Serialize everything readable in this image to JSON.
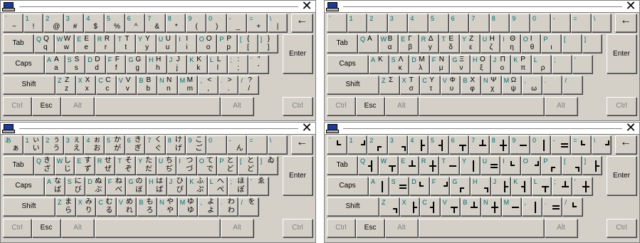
{
  "windows": [
    {
      "id": "english",
      "rows": [
        [
          [
            "`",
            "~",
            ""
          ],
          [
            "1",
            "!",
            ""
          ],
          [
            "2",
            "@",
            ""
          ],
          [
            "3",
            "#",
            ""
          ],
          [
            "4",
            "$",
            ""
          ],
          [
            "5",
            "%",
            ""
          ],
          [
            "6",
            "^",
            ""
          ],
          [
            "7",
            "&",
            ""
          ],
          [
            "8",
            "*",
            ""
          ],
          [
            "9",
            "(",
            ""
          ],
          [
            "0",
            ")",
            ""
          ],
          [
            "-",
            "_",
            ""
          ],
          [
            "=",
            "+",
            ""
          ],
          [
            "\\",
            "|",
            ""
          ]
        ],
        [
          [
            "Q",
            "q",
            "Q"
          ],
          [
            "W",
            "w",
            "W"
          ],
          [
            "E",
            "e",
            "E"
          ],
          [
            "R",
            "r",
            "R"
          ],
          [
            "T",
            "t",
            "T"
          ],
          [
            "Y",
            "y",
            "Y"
          ],
          [
            "U",
            "u",
            "U"
          ],
          [
            "I",
            "i",
            "I"
          ],
          [
            "O",
            "o",
            "O"
          ],
          [
            "P",
            "p",
            "P"
          ],
          [
            "[",
            "[",
            "{"
          ],
          [
            "]",
            "]",
            "}"
          ]
        ],
        [
          [
            "A",
            "a",
            "A"
          ],
          [
            "S",
            "s",
            "S"
          ],
          [
            "D",
            "d",
            "D"
          ],
          [
            "F",
            "f",
            "F"
          ],
          [
            "G",
            "g",
            "G"
          ],
          [
            "H",
            "h",
            "H"
          ],
          [
            "J",
            "j",
            "J"
          ],
          [
            "K",
            "k",
            "K"
          ],
          [
            "L",
            "l",
            "L"
          ],
          [
            ";",
            ";",
            ":"
          ],
          [
            "'",
            "'",
            "\""
          ]
        ],
        [
          [
            "Z",
            "z",
            "Z"
          ],
          [
            "X",
            "x",
            "X"
          ],
          [
            "C",
            "c",
            "C"
          ],
          [
            "V",
            "v",
            "V"
          ],
          [
            "B",
            "b",
            "B"
          ],
          [
            "N",
            "n",
            "N"
          ],
          [
            "M",
            "m",
            "M"
          ],
          [
            ",",
            ",",
            "<"
          ],
          [
            ".",
            ".",
            ">"
          ],
          [
            "/",
            "/",
            "?"
          ]
        ]
      ]
    },
    {
      "id": "greek",
      "rows": [
        [
          [
            "`",
            "",
            ""
          ],
          [
            "1",
            "",
            ""
          ],
          [
            "2",
            "",
            ""
          ],
          [
            "3",
            "",
            ""
          ],
          [
            "4",
            "",
            ""
          ],
          [
            "5",
            "",
            ""
          ],
          [
            "6",
            "",
            ""
          ],
          [
            "7",
            "",
            ""
          ],
          [
            "8",
            "",
            ""
          ],
          [
            "9",
            "",
            ""
          ],
          [
            "0",
            "",
            ""
          ],
          [
            "-",
            "",
            ""
          ],
          [
            "=",
            "",
            ""
          ],
          [
            "\\",
            "",
            ""
          ]
        ],
        [
          [
            "Q",
            "",
            "Α"
          ],
          [
            "W",
            "α",
            "Β"
          ],
          [
            "E",
            "β",
            "Γ"
          ],
          [
            "R",
            "γ",
            "Δ"
          ],
          [
            "T",
            "δ",
            "Ε"
          ],
          [
            "Y",
            "ε",
            "Ζ"
          ],
          [
            "U",
            "ζ",
            "Η"
          ],
          [
            "I",
            "η",
            "Θ"
          ],
          [
            "O",
            "θ",
            "Ι"
          ],
          [
            "P",
            "ι",
            ""
          ],
          [
            "[",
            "",
            ""
          ],
          [
            "]",
            "",
            ""
          ]
        ],
        [
          [
            "A",
            "",
            "Κ"
          ],
          [
            "S",
            "κ",
            "Λ"
          ],
          [
            "D",
            "λ",
            "Μ"
          ],
          [
            "F",
            "μ",
            "Ν"
          ],
          [
            "G",
            "ν",
            "Ξ"
          ],
          [
            "H",
            "ξ",
            "Ο"
          ],
          [
            "J",
            "ο",
            "Π"
          ],
          [
            "K",
            "π",
            "Ρ"
          ],
          [
            "L",
            "ρ",
            ""
          ],
          [
            ";",
            "",
            ""
          ],
          [
            "'",
            "",
            ""
          ]
        ],
        [
          [
            "Z",
            "",
            "Σ"
          ],
          [
            "X",
            "σ",
            "Τ"
          ],
          [
            "C",
            "τ",
            "Υ"
          ],
          [
            "V",
            "υ",
            "Φ"
          ],
          [
            "B",
            "φ",
            "Χ"
          ],
          [
            "N",
            "χ",
            "Ψ"
          ],
          [
            "M",
            "ψ",
            "Ω"
          ],
          [
            ",",
            "ω",
            ""
          ],
          [
            ".",
            "",
            ""
          ],
          [
            "/",
            "",
            ""
          ]
        ]
      ]
    },
    {
      "id": "japanese",
      "rows": [
        [
          [
            "あ",
            "ぁ",
            ""
          ],
          [
            "1",
            "い",
            "ぃ"
          ],
          [
            "2",
            "う",
            "ぅ"
          ],
          [
            "3",
            "え",
            "ぇ"
          ],
          [
            "4",
            "お",
            "ぉ"
          ],
          [
            "5",
            "が",
            "か"
          ],
          [
            "6",
            "ぎ",
            "き"
          ],
          [
            "7",
            "ぐ",
            "く"
          ],
          [
            "8",
            "げ",
            "け"
          ],
          [
            "9",
            "ご",
            "こ"
          ],
          [
            "0",
            "",
            ""
          ],
          [
            "-",
            "ん",
            ""
          ],
          [
            "=",
            "",
            ""
          ],
          [
            "\\",
            "",
            ""
          ]
        ],
        [
          [
            "Q",
            "ざ",
            "き"
          ],
          [
            "W",
            "じ",
            "し"
          ],
          [
            "E",
            "ず",
            "す"
          ],
          [
            "R",
            "ぜ",
            "せ"
          ],
          [
            "T",
            "ぞ",
            "そ"
          ],
          [
            "Y",
            "だ",
            "た"
          ],
          [
            "U",
            "ぢ",
            "ち"
          ],
          [
            "I",
            "づ",
            "つ"
          ],
          [
            "O",
            "で",
            "て"
          ],
          [
            "P",
            "ど",
            "と"
          ],
          [
            "[",
            "ど",
            "と"
          ],
          [
            "]",
            "",
            "ゐ"
          ]
        ],
        [
          [
            "A",
            "ば",
            "な"
          ],
          [
            "S",
            "び",
            "に"
          ],
          [
            "D",
            "ぶ",
            "ぬ"
          ],
          [
            "F",
            "べ",
            "ね"
          ],
          [
            "G",
            "ぼ",
            "の"
          ],
          [
            "H",
            "ぱ",
            "は"
          ],
          [
            "J",
            "ぴ",
            "ひ"
          ],
          [
            "K",
            "ぷ",
            "ふ"
          ],
          [
            "L",
            "ぺ",
            "へ"
          ],
          [
            ";",
            "ぽ",
            "ほ"
          ],
          [
            "'",
            "",
            "ゑ"
          ]
        ],
        [
          [
            "Z",
            "ら",
            "ま"
          ],
          [
            "X",
            "り",
            "み"
          ],
          [
            "C",
            "る",
            "む"
          ],
          [
            "V",
            "れ",
            "め"
          ],
          [
            "B",
            "ろ",
            "も"
          ],
          [
            "N",
            "や",
            "や"
          ],
          [
            "M",
            "ゆ",
            "ゆ"
          ],
          [
            ",",
            "よ",
            "よ"
          ],
          [
            ".",
            "わ",
            "わ"
          ],
          [
            "/",
            "",
            "を"
          ]
        ]
      ]
    },
    {
      "id": "boxdrawing",
      "rows": [
        [
          [
            "`",
            "",
            ""
          ],
          [
            "1",
            "",
            ""
          ],
          [
            "2",
            "",
            ""
          ],
          [
            "3",
            "",
            ""
          ],
          [
            "4",
            "",
            ""
          ],
          [
            "5",
            "",
            ""
          ],
          [
            "6",
            "",
            ""
          ],
          [
            "7",
            "",
            ""
          ],
          [
            "8",
            "",
            ""
          ],
          [
            "9",
            "",
            ""
          ],
          [
            "0",
            "",
            ""
          ],
          [
            "-",
            "",
            ""
          ],
          [
            "=",
            "",
            ""
          ],
          [
            "\\",
            "",
            ""
          ]
        ],
        [
          [
            "Q",
            "",
            ""
          ],
          [
            "W",
            "",
            ""
          ],
          [
            "E",
            "",
            ""
          ],
          [
            "R",
            "",
            ""
          ],
          [
            "T",
            "",
            ""
          ],
          [
            "Y",
            "",
            ""
          ],
          [
            "U",
            "",
            ""
          ],
          [
            "I",
            "",
            ""
          ],
          [
            "O",
            "",
            ""
          ],
          [
            "P",
            "",
            ""
          ],
          [
            "[",
            "",
            ""
          ],
          [
            "]",
            "",
            ""
          ]
        ],
        [
          [
            "A",
            "",
            ""
          ],
          [
            "S",
            "",
            ""
          ],
          [
            "D",
            "",
            ""
          ],
          [
            "F",
            "",
            ""
          ],
          [
            "G",
            "",
            ""
          ],
          [
            "H",
            "",
            ""
          ],
          [
            "J",
            "",
            ""
          ],
          [
            "K",
            "",
            ""
          ],
          [
            "L",
            "",
            ""
          ],
          [
            ";",
            "",
            ""
          ],
          [
            "'",
            "",
            ""
          ]
        ],
        [
          [
            "Z",
            "",
            ""
          ],
          [
            "X",
            "",
            ""
          ],
          [
            "C",
            "",
            ""
          ],
          [
            "V",
            "",
            ""
          ],
          [
            "B",
            "",
            ""
          ],
          [
            "N",
            "",
            ""
          ],
          [
            "M",
            "",
            ""
          ],
          [
            ",",
            "",
            ""
          ],
          [
            ".",
            "",
            ""
          ],
          [
            "/",
            "",
            ""
          ]
        ]
      ]
    }
  ],
  "labels": {
    "tab": "Tab",
    "caps": "Caps",
    "shift": "Shift",
    "enter": "Enter",
    "ctrl": "Ctrl",
    "esc": "Esc",
    "alt": "Alt",
    "backspace": "←",
    "close": "✕"
  },
  "colors": {
    "key_face": "#d4d0c8",
    "teal_label": "#006b6b",
    "disabled": "#808080"
  }
}
